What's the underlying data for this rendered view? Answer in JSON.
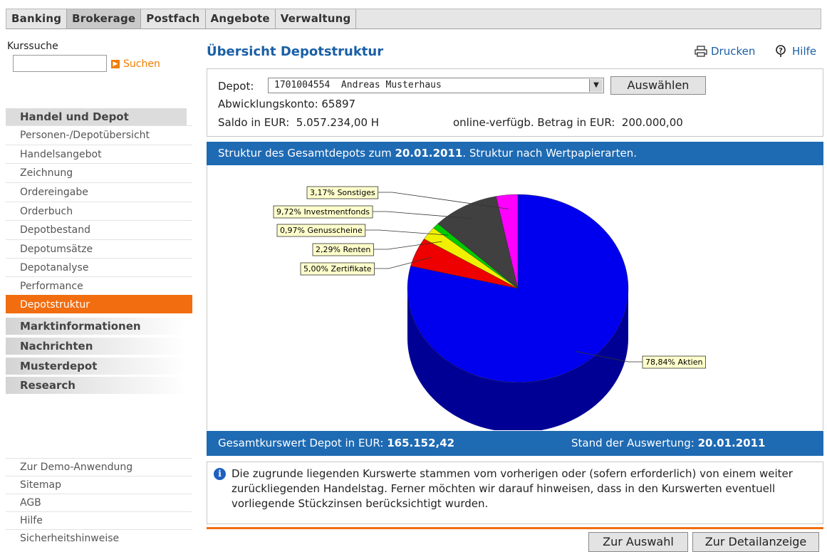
{
  "topnav": {
    "tabs": [
      "Banking",
      "Brokerage",
      "Postfach",
      "Angebote",
      "Verwaltung"
    ],
    "active": "Brokerage"
  },
  "sidebar": {
    "search_label": "Kurssuche",
    "search_button": "Suchen",
    "section_handel": "Handel und Depot",
    "items": [
      "Personen-/Depotübersicht",
      "Handelsangebot",
      "Zeichnung",
      "Ordereingabe",
      "Orderbuch",
      "Depotbestand",
      "Depotumsätze",
      "Depotanalyse",
      "Performance",
      "Depotstruktur"
    ],
    "active_item": "Depotstruktur",
    "sections": [
      "Marktinformationen",
      "Nachrichten",
      "Musterdepot",
      "Research"
    ],
    "bottom_links": [
      "Zur Demo-Anwendung",
      "Sitemap",
      "AGB",
      "Hilfe",
      "Sicherheitshinweise"
    ]
  },
  "header": {
    "title": "Übersicht Depotstruktur",
    "print_label": "Drucken",
    "help_label": "Hilfe"
  },
  "depot": {
    "label": "Depot:",
    "selected": "1701004554  Andreas Musterhaus",
    "select_button": "Auswählen",
    "abwicklung": "Abwicklungskonto: 65897",
    "saldo": "Saldo in EUR:  5.057.234,00 H",
    "online_betrag": "online-verfügb. Betrag in EUR:  200.000,00"
  },
  "structure_bar": {
    "prefix": "Struktur des Gesamtdepots zum ",
    "date": "20.01.2011",
    "suffix": ". Struktur nach Wertpapierarten."
  },
  "chart_data": {
    "type": "pie",
    "title": "",
    "slices": [
      {
        "label": "78,84% Aktien",
        "value": 78.84,
        "color": "#0000ee"
      },
      {
        "label": "5,00% Zertifikate",
        "value": 5.0,
        "color": "#ee0000"
      },
      {
        "label": "2,29% Renten",
        "value": 2.29,
        "color": "#f0f000"
      },
      {
        "label": "0,97% Genusscheine",
        "value": 0.97,
        "color": "#00cc00"
      },
      {
        "label": "9,72% Investmentfonds",
        "value": 9.72,
        "color": "#404040"
      },
      {
        "label": "3,17% Sonstiges",
        "value": 3.17,
        "color": "#ff00ff"
      }
    ]
  },
  "total": {
    "label": "Gesamtkurswert Depot in EUR:",
    "value": "165.152,42",
    "stand_label": "Stand der Auswertung:",
    "stand_value": "20.01.2011"
  },
  "info": {
    "text": "Die zugrunde liegenden Kurswerte stammen vom vorherigen oder (sofern erforderlich) von einem weiter zurückliegenden Handelstag. Ferner möchten wir darauf hinweisen, dass in den Kurswerten eventuell vorliegende Stückzinsen berücksichtigt wurden."
  },
  "buttons": {
    "back": "Zur Auswahl",
    "detail": "Zur Detailanzeige"
  },
  "icons": {
    "print": "printer-icon",
    "help": "help-icon",
    "info": "info-icon",
    "search": "arrow-right-icon",
    "dropdown": "dropdown-arrow-icon"
  }
}
